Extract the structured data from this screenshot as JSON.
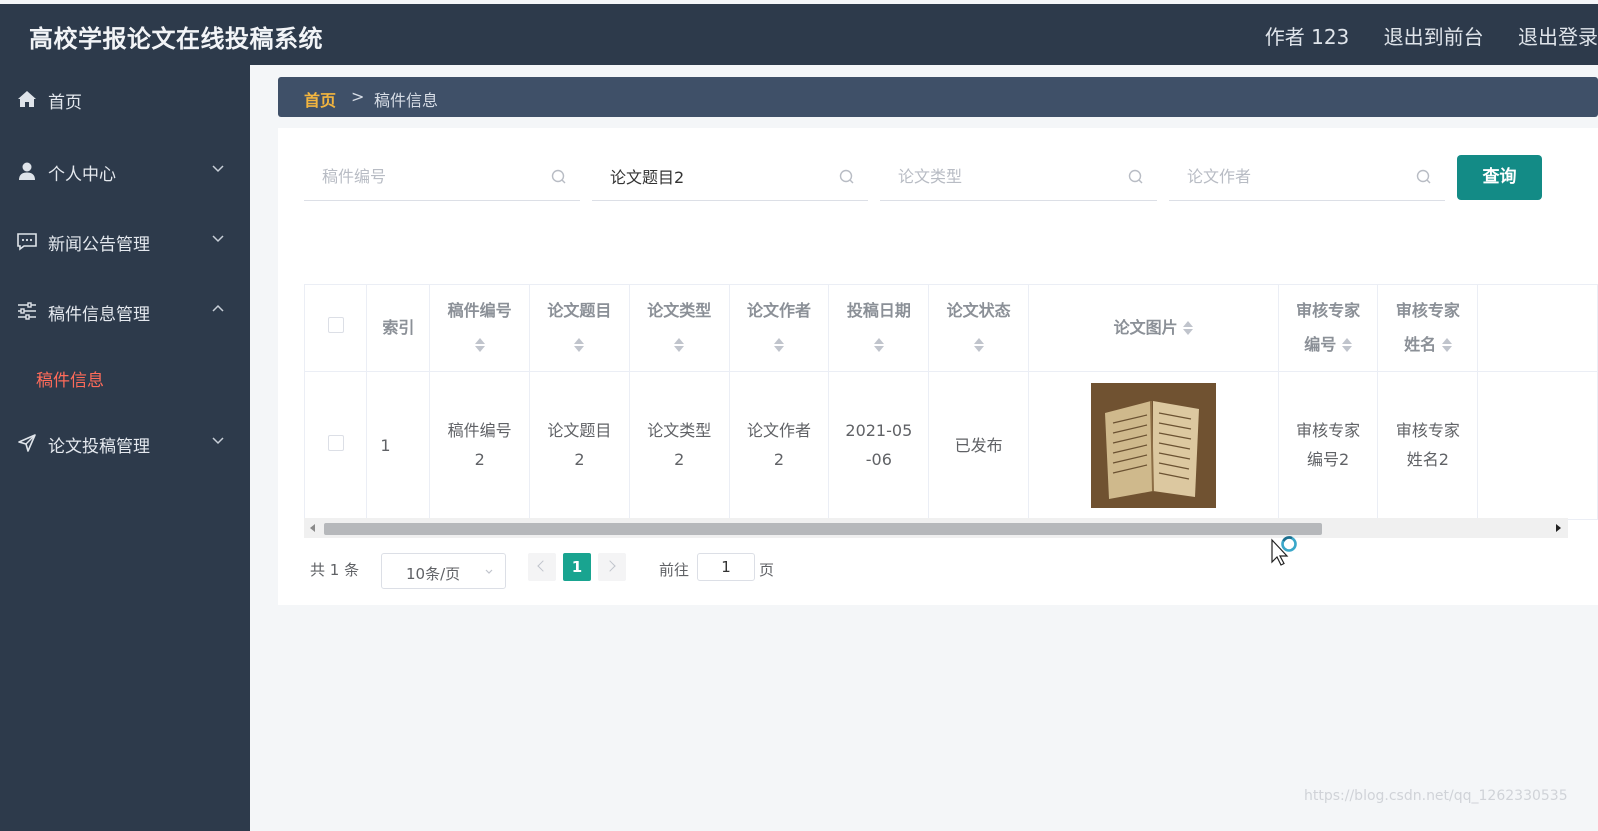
{
  "app_title": "高校学报论文在线投稿系统",
  "header": {
    "user": "作者 123",
    "to_front": "退出到前台",
    "logout": "退出登录"
  },
  "sidebar": {
    "items": [
      {
        "label": "首页",
        "icon": "home-icon"
      },
      {
        "label": "个人中心",
        "icon": "user-icon"
      },
      {
        "label": "新闻公告管理",
        "icon": "message-icon"
      },
      {
        "label": "稿件信息管理",
        "icon": "sliders-icon",
        "expanded": true
      },
      {
        "label": "论文投稿管理",
        "icon": "send-icon"
      }
    ],
    "sub_active": "稿件信息"
  },
  "breadcrumb": {
    "home": "首页",
    "sep": ">",
    "current": "稿件信息"
  },
  "search": {
    "fields": [
      {
        "placeholder": "稿件编号",
        "value": ""
      },
      {
        "placeholder": "论文题目",
        "value": "论文题目2"
      },
      {
        "placeholder": "论文类型",
        "value": ""
      },
      {
        "placeholder": "论文作者",
        "value": ""
      }
    ],
    "button": "查询"
  },
  "table": {
    "headers": {
      "index": "索引",
      "c1": "稿件编号",
      "c2": "论文题目",
      "c3": "论文类型",
      "c4": "论文作者",
      "c5": "投稿日期",
      "c6": "论文状态",
      "c7": "论文图片",
      "c8a": "审核专家",
      "c8b": "编号",
      "c9a": "审核专家",
      "c9b": "姓名"
    },
    "row": {
      "index": "1",
      "c1a": "稿件编号",
      "c1b": "2",
      "c2a": "论文题目",
      "c2b": "2",
      "c3a": "论文类型",
      "c3b": "2",
      "c4a": "论文作者",
      "c4b": "2",
      "c5a": "2021-05",
      "c5b": "-06",
      "c6": "已发布",
      "c8a": "审核专家",
      "c8b": "编号2",
      "c9a": "审核专家",
      "c9b": "姓名2"
    }
  },
  "pagination": {
    "total": "共 1 条",
    "page_size": "10条/页",
    "current": "1",
    "goto_label": "前往",
    "goto_value": "1",
    "page_unit": "页"
  },
  "watermark": "https://blog.csdn.net/qq_1262330535",
  "colors": {
    "sidebar_bg": "#2d3a4b",
    "breadcrumb_bg": "#3f5068",
    "accent": "#138b86",
    "active_menu": "#ff6b5a",
    "breadcrumb_home": "#f3b53f"
  }
}
